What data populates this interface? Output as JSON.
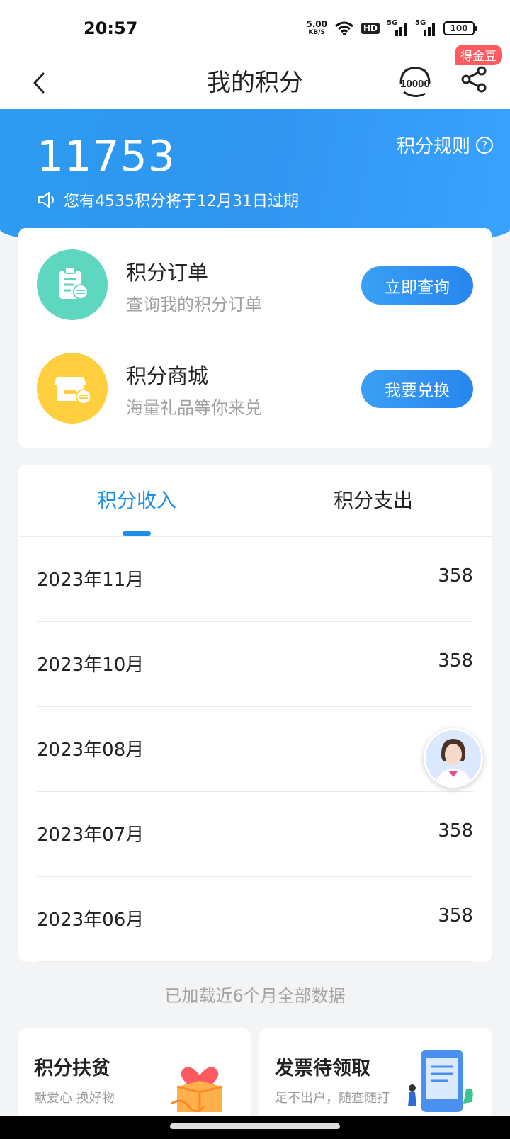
{
  "status_bar": {
    "time": "20:57",
    "net_speed": "5.00",
    "net_unit": "KB/S",
    "hd_label": "HD",
    "signal_label_1": "5G",
    "signal_label_2": "5G",
    "battery": "100"
  },
  "nav": {
    "title": "我的积分",
    "service_label": "10000",
    "badge": "得金豆"
  },
  "header": {
    "points": "11753",
    "rules": "积分规则",
    "expire_notice": "您有4535积分将于12月31日过期"
  },
  "services": [
    {
      "title": "积分订单",
      "subtitle": "查询我的积分订单",
      "button": "立即查询",
      "icon": "order-clipboard-icon",
      "color": "#5fd6c0"
    },
    {
      "title": "积分商城",
      "subtitle": "海量礼品等你来兑",
      "button": "我要兑换",
      "icon": "shop-icon",
      "color": "#ffcf3f"
    }
  ],
  "tabs": [
    {
      "label": "积分收入",
      "active": true
    },
    {
      "label": "积分支出",
      "active": false
    }
  ],
  "records": [
    {
      "month": "2023年11月",
      "value": "358"
    },
    {
      "month": "2023年10月",
      "value": "358"
    },
    {
      "month": "2023年08月",
      "value": ""
    },
    {
      "month": "2023年07月",
      "value": "358"
    },
    {
      "month": "2023年06月",
      "value": "358"
    }
  ],
  "loaded_note": "已加载近6个月全部数据",
  "promos": [
    {
      "title": "积分扶贫",
      "subtitle": "献爱心 换好物"
    },
    {
      "title": "发票待领取",
      "subtitle": "足不出户，随查随打"
    }
  ],
  "colors": {
    "accent": "#1e8fe6",
    "header_blue": "#2e9bf0",
    "badge_red": "#ff5a5f"
  }
}
